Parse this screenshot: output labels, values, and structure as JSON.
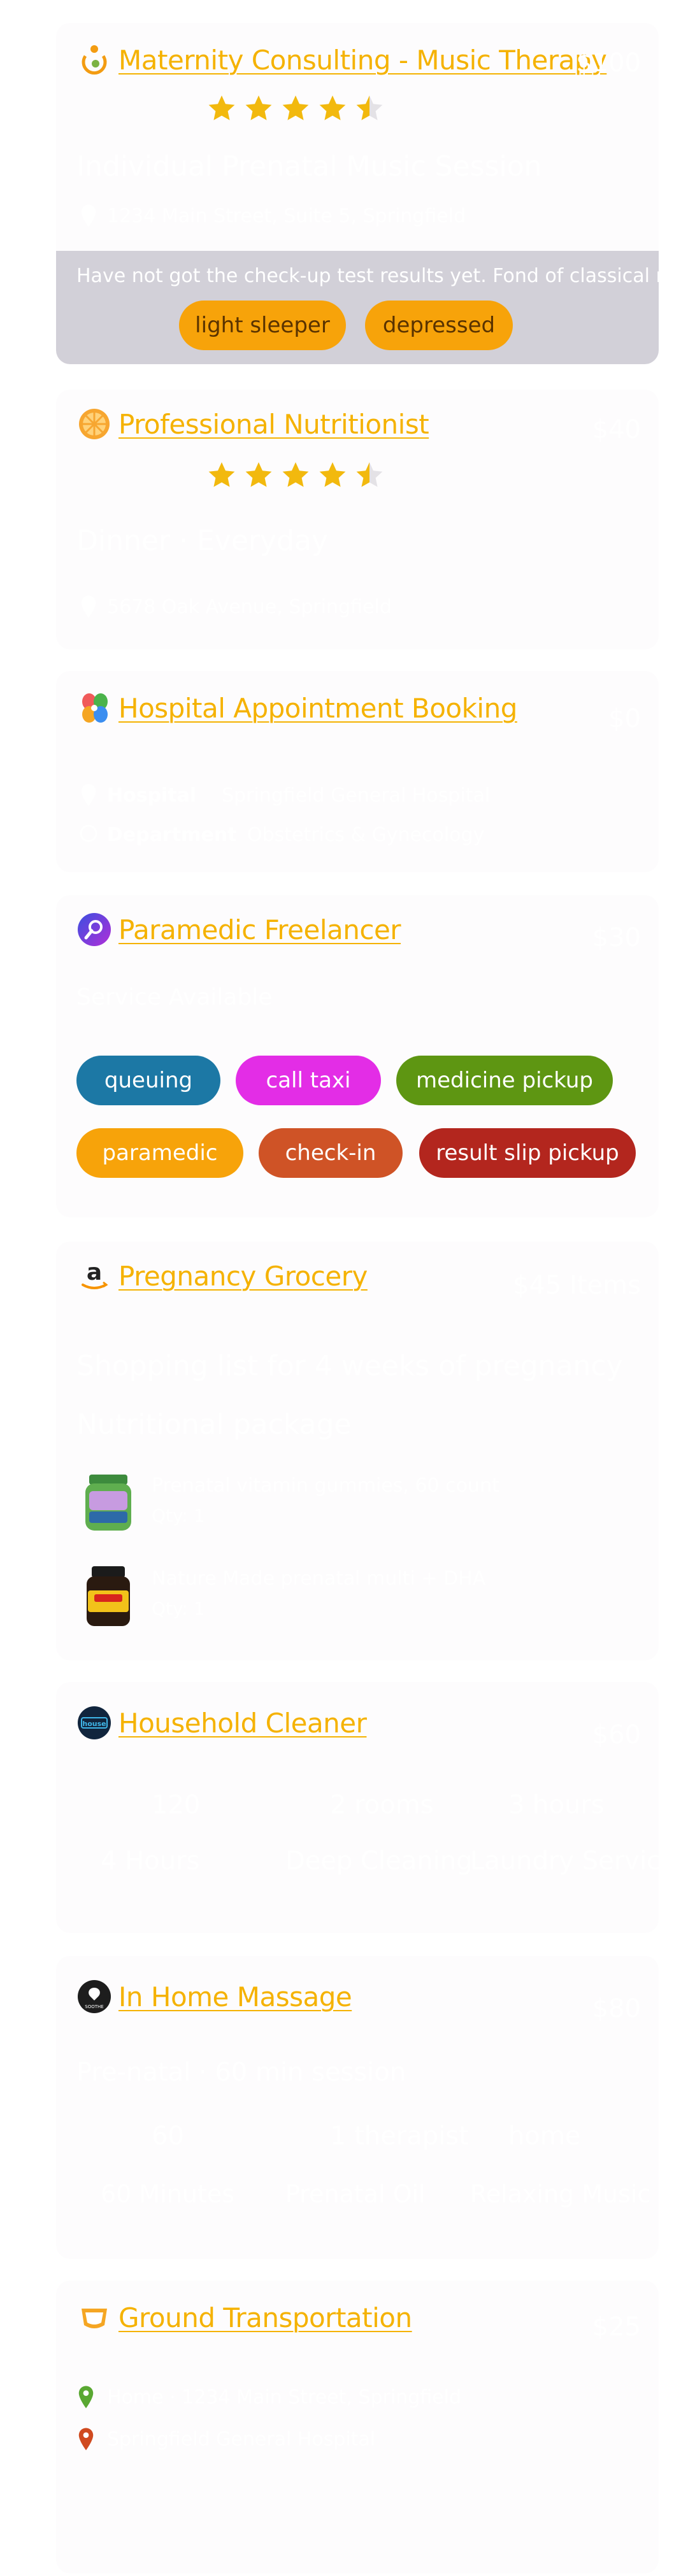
{
  "cards": {
    "maternity": {
      "title": "Maternity Consulting - Music Therapy",
      "price": "$100",
      "rating": 4.5,
      "subtitle": "Individual Prenatal Music Session",
      "address": "1234 Main Street, Suite 5, Springfield",
      "note": "Have not got the check-up test results yet. Fond of classical music.",
      "tags": [
        "light sleeper",
        "depressed"
      ]
    },
    "nutritionist": {
      "title": "Professional Nutritionist",
      "price": "$40",
      "rating": 4.5,
      "subtitle": "Dinner · Everyday",
      "address": "5678 Oak Avenue, Springfield"
    },
    "hospital": {
      "title": "Hospital Appointment Booking",
      "price": "$0",
      "hospital_label": "Hospital",
      "hospital_value": "Springfield General Hospital",
      "department_label": "Department",
      "department_value": "Obstetrics & Gynecology"
    },
    "paramedic": {
      "title": "Paramedic Freelancer",
      "price": "$30",
      "subtitle": "Service Available",
      "tags": [
        "queuing",
        "call taxi",
        "medicine pickup",
        "paramedic",
        "check-in",
        "result slip pickup"
      ]
    },
    "grocery": {
      "title": "Pregnancy Grocery",
      "price": "$45 Items",
      "headline": "Shopping list for 4 weeks of pregnancy",
      "subhead": "Nutritional package",
      "items": [
        {
          "name": "Prenatal vitamin gummies, 60 count",
          "qty": "Qty: 1"
        },
        {
          "name": "Nature Made prenatal multi + DHA",
          "qty": "Qty: 1"
        }
      ]
    },
    "cleaner": {
      "title": "Household Cleaner",
      "price": "$60",
      "stats": [
        "120",
        "2 rooms",
        "3 hours"
      ],
      "stat_labels": [
        "4 Hours",
        "Deep Cleaning",
        "Laundry Service"
      ]
    },
    "massage": {
      "title": "In Home Massage",
      "price": "$80",
      "subtitle": "Pre-natal · 60 min session",
      "stats": [
        "60",
        "1 therapist",
        "home"
      ],
      "stat_labels": [
        "60 Minutes",
        "Prenatal Oil",
        "Relaxing Music"
      ]
    },
    "transport": {
      "title": "Ground Transportation",
      "price": "$25",
      "from": "Home · 1234 Main Street, Springfield",
      "to": "Springfield General Hospital"
    }
  },
  "colors": {
    "accent": "#f5b200",
    "chip_orange": "#f7a30a",
    "chip_blue": "#1c78a5",
    "chip_magenta": "#e32de6",
    "chip_green": "#5e9612",
    "chip_rust": "#cf5326",
    "chip_red": "#b3261e",
    "star": "#f2b90e",
    "note_band": "#d2d0d8"
  }
}
